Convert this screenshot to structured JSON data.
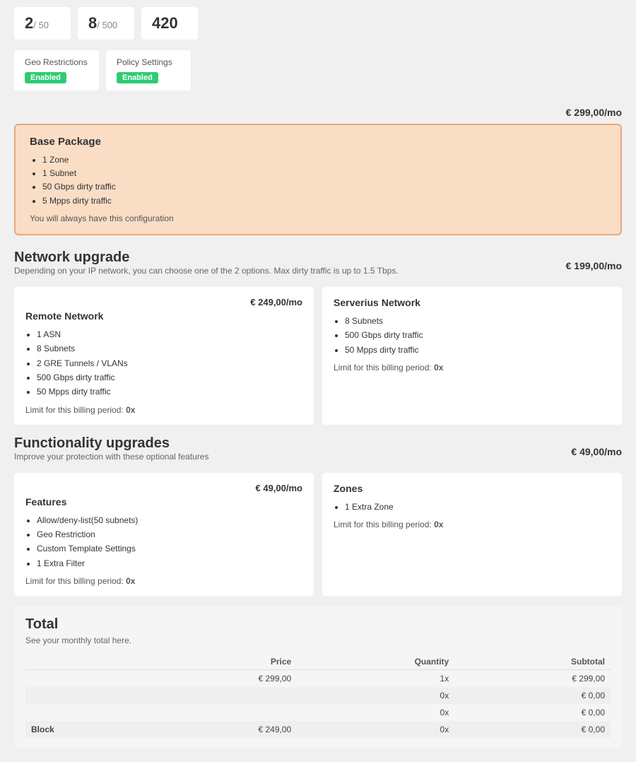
{
  "stats": [
    {
      "value": "2",
      "denom": "/ 50"
    },
    {
      "value": "8",
      "denom": "/ 500"
    },
    {
      "value": "420",
      "denom": ""
    }
  ],
  "features": [
    {
      "label": "Geo Restrictions",
      "badge": "Enabled"
    },
    {
      "label": "Policy Settings",
      "badge": "Enabled"
    }
  ],
  "base_package": {
    "price": "€ 299,00/mo",
    "title": "Base Package",
    "items": [
      "1 Zone",
      "1 Subnet",
      "50 Gbps dirty traffic",
      "5 Mpps dirty traffic"
    ],
    "note": "You will always have this configuration"
  },
  "network_upgrade": {
    "title": "Network upgrade",
    "subtitle": "Depending on your IP network, you can choose one of the 2 options. Max dirty traffic is up to 1.5 Tbps.",
    "price_label": "€ 199,00/mo",
    "cards": [
      {
        "title": "Remote Network",
        "price": "€ 249,00/mo",
        "items": [
          "1 ASN",
          "8 Subnets",
          "2 GRE Tunnels / VLANs",
          "500 Gbps dirty traffic",
          "50 Mpps dirty traffic"
        ],
        "limit": "0x"
      },
      {
        "title": "Serverius Network",
        "items": [
          "8 Subnets",
          "500 Gbps dirty traffic",
          "50 Mpps dirty traffic"
        ],
        "limit": "0x"
      }
    ]
  },
  "functionality_upgrades": {
    "title": "Functionality upgrades",
    "subtitle": "Improve your protection with these optional features",
    "price_label": "€ 49,00/mo",
    "cards": [
      {
        "title": "Features",
        "price": "€ 49,00/mo",
        "items": [
          "Allow/deny-list(50 subnets)",
          "Geo Restriction",
          "Custom Template Settings",
          "1 Extra Filter"
        ],
        "limit": "0x"
      },
      {
        "title": "Zones",
        "items": [
          "1 Extra Zone"
        ],
        "limit": "0x"
      }
    ]
  },
  "total": {
    "title": "Total",
    "subtitle": "See your monthly total here.",
    "columns": [
      "",
      "Price",
      "Quantity",
      "Subtotal"
    ],
    "rows": [
      {
        "label": "",
        "price": "€ 299,00",
        "quantity": "1x",
        "subtotal": "€ 299,00"
      },
      {
        "label": "",
        "price": "",
        "quantity": "0x",
        "subtotal": "€ 0,00"
      },
      {
        "label": "",
        "price": "",
        "quantity": "0x",
        "subtotal": "€ 0,00"
      },
      {
        "label": "Block",
        "price": "€ 249,00",
        "quantity": "0x",
        "subtotal": "€ 0,00"
      }
    ]
  }
}
